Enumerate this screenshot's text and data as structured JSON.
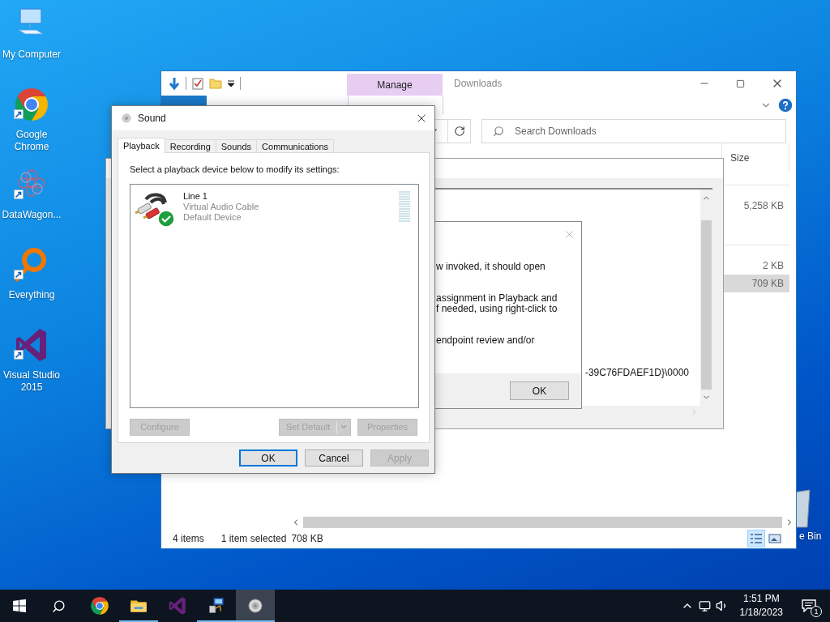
{
  "desktop": {
    "icons": [
      {
        "label": "My Computer",
        "kind": "computer",
        "shortcut": false
      },
      {
        "label": "Google Chrome",
        "kind": "chrome",
        "shortcut": true
      },
      {
        "label": "DataWagon...",
        "kind": "datawagon",
        "shortcut": true
      },
      {
        "label": "Everything",
        "kind": "everything",
        "shortcut": true
      },
      {
        "label": "Visual Studio 2015",
        "kind": "vs",
        "shortcut": true
      }
    ],
    "partial_icon": {
      "label": "e Bin",
      "kind": "recycle"
    }
  },
  "explorer": {
    "context_group": "Manage",
    "title": "Downloads",
    "ribbon_tabs": [
      {
        "kind": "file"
      },
      {
        "kind": "context"
      }
    ],
    "search": {
      "placeholder": "Search Downloads"
    },
    "columns": [
      {
        "label": "Size"
      }
    ],
    "groups": [
      {
        "rows": [
          {
            "size": "5,258 KB",
            "selected": false
          }
        ]
      },
      {
        "rows": [
          {
            "size": "2 KB",
            "selected": false
          },
          {
            "size": "709 KB",
            "selected": true
          }
        ]
      }
    ],
    "status": {
      "count": "4 items",
      "selection": "1 item selected",
      "selection_size": "708 KB"
    },
    "view_buttons": [
      {
        "kind": "details",
        "selected": true
      },
      {
        "kind": "thumbnails",
        "selected": false
      }
    ]
  },
  "background_window": {
    "text": "-39C76FDAEF1D}\\0000"
  },
  "message_box": {
    "paragraphs": [
      {
        "lines": [
          "w invoked, it should open"
        ]
      },
      {
        "lines": [
          "assignment in Playback and",
          "f needed, using right-click to"
        ]
      },
      {
        "lines": [
          "endpoint review and/or"
        ]
      }
    ],
    "button": "OK"
  },
  "sound_dialog": {
    "title": "Sound",
    "tabs": [
      {
        "label": "Playback",
        "selected": true
      },
      {
        "label": "Recording",
        "selected": false
      },
      {
        "label": "Sounds",
        "selected": false
      },
      {
        "label": "Communications",
        "selected": false
      }
    ],
    "instruction": "Select a playback device below to modify its settings:",
    "devices": [
      {
        "name": "Line 1",
        "driver": "Virtual Audio Cable",
        "status": "Default Device",
        "default": true,
        "selected": false
      }
    ],
    "device_buttons": [
      {
        "label": "Configure",
        "kind": "plain",
        "disabled": true
      },
      {
        "label": "Set Default",
        "kind": "split",
        "disabled": true
      },
      {
        "label": "Properties",
        "kind": "plain",
        "disabled": true
      }
    ],
    "footer_buttons": [
      {
        "label": "OK",
        "default": true,
        "disabled": false
      },
      {
        "label": "Cancel",
        "default": false,
        "disabled": false
      },
      {
        "label": "Apply",
        "default": false,
        "disabled": true
      }
    ]
  },
  "taskbar": {
    "apps": [
      {
        "kind": "chrome",
        "running": false,
        "active": false
      },
      {
        "kind": "folder",
        "running": true,
        "active": false
      },
      {
        "kind": "vs",
        "running": false,
        "active": false
      },
      {
        "kind": "netapp",
        "running": true,
        "active": false
      },
      {
        "kind": "sound",
        "running": true,
        "active": true
      }
    ],
    "time": "1:51 PM",
    "date": "1/18/2023",
    "notifications": "1"
  }
}
